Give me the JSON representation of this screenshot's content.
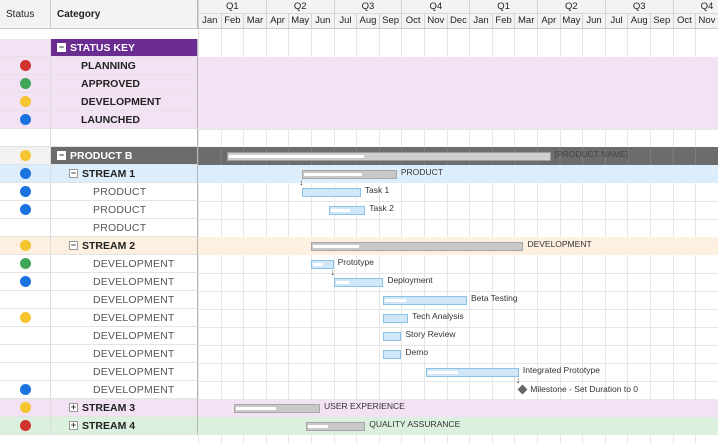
{
  "header": {
    "status_label": "Status",
    "category_label": "Category",
    "quarters": [
      "Q1",
      "Q2",
      "Q3",
      "Q4",
      "Q1",
      "Q2",
      "Q3",
      "Q4"
    ],
    "months": [
      "Jan",
      "Feb",
      "Mar",
      "Apr",
      "May",
      "Jun",
      "Jul",
      "Aug",
      "Sep",
      "Oct",
      "Nov",
      "Dec",
      "Jan",
      "Feb",
      "Mar",
      "Apr",
      "May",
      "Jun",
      "Jul",
      "Aug",
      "Sep",
      "Oct",
      "Nov"
    ]
  },
  "colors": {
    "status_key_header": "#6a2c91",
    "status_key_rows": "#f3e2f4",
    "product_header": "#6c6c6c",
    "stream1_row": "#dcedfb",
    "stream2_row": "#fdf0e0",
    "stream3_row": "#f3e2f4",
    "stream4_row": "#dcf0e0",
    "red": "#d0342c",
    "green": "#3fa659",
    "yellow": "#f5c530",
    "blue": "#1b73e0"
  },
  "rows": [
    {
      "type": "section",
      "label": "STATUS KEY",
      "status": "",
      "toggle": "minus",
      "theme": "key"
    },
    {
      "type": "key",
      "label": "PLANNING",
      "status": "red",
      "theme": "keyrow"
    },
    {
      "type": "key",
      "label": "APPROVED",
      "status": "green",
      "theme": "keyrow"
    },
    {
      "type": "key",
      "label": "DEVELOPMENT",
      "status": "yellow",
      "theme": "keyrow"
    },
    {
      "type": "key",
      "label": "LAUNCHED",
      "status": "blue",
      "theme": "keyrow"
    },
    {
      "type": "blank",
      "label": "",
      "status": "",
      "theme": "plain"
    },
    {
      "type": "section",
      "label": "PRODUCT B",
      "status": "yellow",
      "toggle": "minus",
      "theme": "product",
      "bar": {
        "kind": "gray",
        "start": 1.3,
        "end": 15.6,
        "progress": 0.42,
        "label": "[PRODUCT NAME]"
      }
    },
    {
      "type": "stream",
      "label": "STREAM 1",
      "status": "blue",
      "toggle": "minus",
      "theme": "stream1",
      "bar": {
        "kind": "gray",
        "start": 4.6,
        "end": 8.8,
        "progress": 0.62,
        "label": "PRODUCT"
      }
    },
    {
      "type": "task",
      "label": "PRODUCT",
      "status": "blue",
      "theme": "plain",
      "bar": {
        "kind": "blue",
        "start": 4.6,
        "end": 7.2,
        "progress": 0.0,
        "label": "Task 1"
      }
    },
    {
      "type": "task",
      "label": "PRODUCT",
      "status": "blue",
      "theme": "plain",
      "bar": {
        "kind": "blue",
        "start": 5.8,
        "end": 7.4,
        "progress": 0.55,
        "label": "Task 2"
      }
    },
    {
      "type": "task",
      "label": "PRODUCT",
      "status": "",
      "theme": "plain"
    },
    {
      "type": "stream",
      "label": "STREAM 2",
      "status": "yellow",
      "toggle": "minus",
      "theme": "stream2",
      "bar": {
        "kind": "gray",
        "start": 5.0,
        "end": 14.4,
        "progress": 0.22,
        "label": "DEVELOPMENT"
      }
    },
    {
      "type": "task",
      "label": "DEVELOPMENT",
      "status": "green",
      "theme": "plain",
      "bar": {
        "kind": "blue",
        "start": 5.0,
        "end": 6.0,
        "progress": 0.5,
        "label": "Prototype"
      }
    },
    {
      "type": "task",
      "label": "DEVELOPMENT",
      "status": "blue",
      "theme": "plain",
      "bar": {
        "kind": "blue",
        "start": 6.0,
        "end": 8.2,
        "progress": 0.28,
        "label": "Deployment"
      }
    },
    {
      "type": "task",
      "label": "DEVELOPMENT",
      "status": "",
      "theme": "plain",
      "bar": {
        "kind": "blue",
        "start": 8.2,
        "end": 11.9,
        "progress": 0.25,
        "label": "Beta Testing"
      }
    },
    {
      "type": "task",
      "label": "DEVELOPMENT",
      "status": "yellow",
      "theme": "plain",
      "bar": {
        "kind": "blue",
        "start": 8.2,
        "end": 9.3,
        "progress": 0.0,
        "label": "Tech Analysis"
      }
    },
    {
      "type": "task",
      "label": "DEVELOPMENT",
      "status": "",
      "theme": "plain",
      "bar": {
        "kind": "blue",
        "start": 8.2,
        "end": 9.0,
        "progress": 0.0,
        "label": "Story Review"
      }
    },
    {
      "type": "task",
      "label": "DEVELOPMENT",
      "status": "",
      "theme": "plain",
      "bar": {
        "kind": "blue",
        "start": 8.2,
        "end": 9.0,
        "progress": 0.0,
        "label": "Demo"
      }
    },
    {
      "type": "task",
      "label": "DEVELOPMENT",
      "status": "",
      "theme": "plain",
      "bar": {
        "kind": "blue",
        "start": 10.1,
        "end": 14.2,
        "progress": 0.33,
        "label": "Integrated Prototype"
      }
    },
    {
      "type": "task",
      "label": "DEVELOPMENT",
      "status": "blue",
      "theme": "plain",
      "milestone": {
        "at": 14.35,
        "label": "Milestone - Set Duration to 0"
      }
    },
    {
      "type": "stream",
      "label": "STREAM 3",
      "status": "yellow",
      "toggle": "plus",
      "theme": "stream3",
      "bar": {
        "kind": "gray",
        "start": 1.6,
        "end": 5.4,
        "progress": 0.48,
        "label": "USER EXPERIENCE"
      }
    },
    {
      "type": "stream",
      "label": "STREAM 4",
      "status": "red",
      "toggle": "plus",
      "theme": "stream4",
      "bar": {
        "kind": "gray",
        "start": 4.8,
        "end": 7.4,
        "progress": 0.35,
        "label": "QUALITY ASSURANCE"
      }
    }
  ]
}
